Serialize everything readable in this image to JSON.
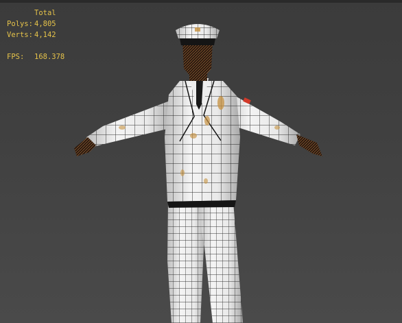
{
  "stats": {
    "header": "Total",
    "polys_label": "Polys:",
    "polys_value": "4,805",
    "verts_label": "Verts:",
    "verts_value": "4,142",
    "fps_label": "FPS:",
    "fps_value": "168.378"
  },
  "colors": {
    "stats_text": "#e6c34a",
    "viewport_bg": "#404040",
    "mesh_fill": "#f2f2f2",
    "mesh_wire": "#111111",
    "skin": "#3a2416",
    "stain": "#c79240",
    "badge": "#d23a2a"
  },
  "viewport": {
    "mode": "wireframe-on-shaded",
    "object": "sailor-officer-character"
  }
}
